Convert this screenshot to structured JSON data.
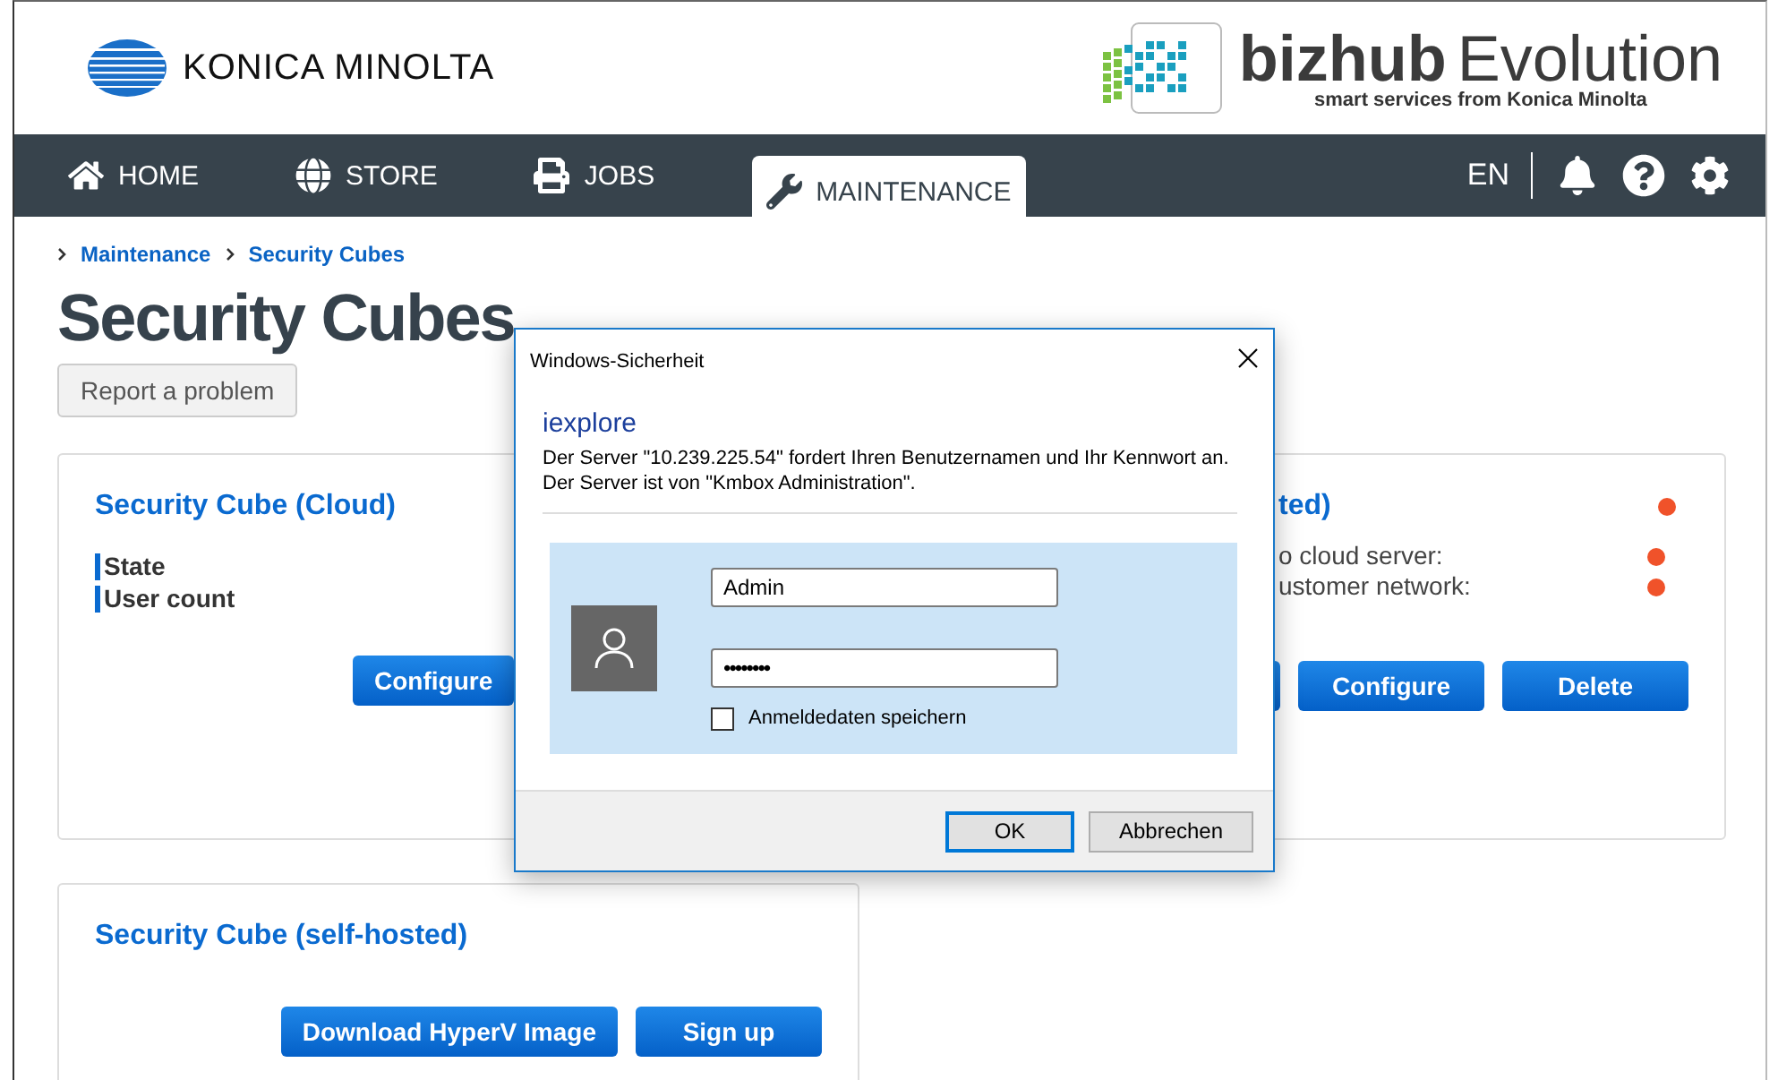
{
  "header": {
    "brand": "KONICA MINOLTA",
    "product_bold": "bizhub",
    "product_light": "Evolution",
    "tagline": "smart services from Konica Minolta"
  },
  "nav": {
    "items": [
      {
        "label": "HOME",
        "selected": false
      },
      {
        "label": "STORE",
        "selected": false
      },
      {
        "label": "JOBS",
        "selected": false
      },
      {
        "label": "MAINTENANCE",
        "selected": true
      }
    ],
    "language": "EN"
  },
  "breadcrumb": [
    "Maintenance",
    "Security Cubes"
  ],
  "title": "Security Cubes",
  "report_button": "Report a problem",
  "cards": [
    {
      "title": "Security Cube (Cloud)",
      "fields": [
        "State",
        "User count"
      ],
      "buttons": [
        "Configure"
      ]
    },
    {
      "title": "ted)",
      "color": "#f0522a",
      "rows": [
        {
          "label": "o cloud server:",
          "color": "#f0522a"
        },
        {
          "label": "ustomer network:",
          "color": "#f0522a"
        }
      ],
      "buttons": [
        "Configure",
        "Delete"
      ]
    },
    {
      "title": "Security Cube (self-hosted)",
      "buttons": [
        "Download HyperV Image",
        "Sign up"
      ]
    }
  ],
  "dialog": {
    "title": "Windows-Sicherheit",
    "app": "iexplore",
    "message": "Der Server \"10.239.225.54\" fordert Ihren Benutzernamen und Ihr Kennwort an. Der Server ist von \"Kmbox Administration\".",
    "username": "Admin",
    "password": "••••••••",
    "remember": {
      "label": "Anmeldedaten speichern",
      "checked": false
    },
    "buttons": [
      {
        "label": "OK",
        "default": true
      },
      {
        "label": "Abbrechen",
        "default": false
      }
    ]
  }
}
